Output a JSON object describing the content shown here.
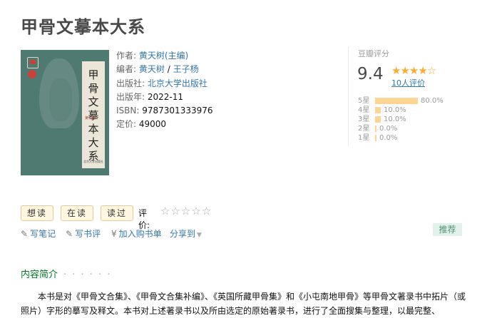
{
  "book": {
    "title": "甲骨文摹本大系",
    "cover_text": "甲骨文摹本大系",
    "cover_volume": "第一冊",
    "cover_publisher": "北京大学出版社"
  },
  "info": {
    "author_label": "作者:",
    "author": "黄天树(主编)",
    "editor_label": "编者:",
    "editor1": "黄天树",
    "editor_sep": " / ",
    "editor2": "王子杨",
    "publisher_label": "出版社:",
    "publisher": "北京大学出版社",
    "year_label": "出版年:",
    "year": "2022-11",
    "isbn_label": "ISBN:",
    "isbn": "9787301333976",
    "price_label": "定价:",
    "price": "49000"
  },
  "rating": {
    "header": "豆瓣评分",
    "score": "9.4",
    "stars": "★★★★☆",
    "count": "10人评价",
    "rows": [
      {
        "label": "5星",
        "pct": "80.0%",
        "value": 0.8
      },
      {
        "label": "4星",
        "pct": "10.0%",
        "value": 0.1
      },
      {
        "label": "3星",
        "pct": "10.0%",
        "value": 0.1
      },
      {
        "label": "2星",
        "pct": "0.0%",
        "value": 0.0
      },
      {
        "label": "1星",
        "pct": "0.0%",
        "value": 0.0
      }
    ]
  },
  "actions": {
    "want": "想读",
    "reading": "在读",
    "read": "读过",
    "rate_label": "评价:",
    "rate_stars": "☆☆☆☆☆"
  },
  "links": {
    "note": "写笔记",
    "review": "写书评",
    "cart": "加入购书单",
    "share": "分享到",
    "recommend": "推荐"
  },
  "intro": {
    "heading": "内容简介",
    "dots": "· · · · · ·",
    "text": "本书是对《甲骨文合集》、《甲骨文合集补编》、《英国所藏甲骨集》和《小屯南地甲骨》等甲骨文著录书中拓片（或照片）字形的摹写及释文。本书对上述著录书以及所由选定的原始著录书，进行了全面搜集与整理，以最完整、"
  }
}
